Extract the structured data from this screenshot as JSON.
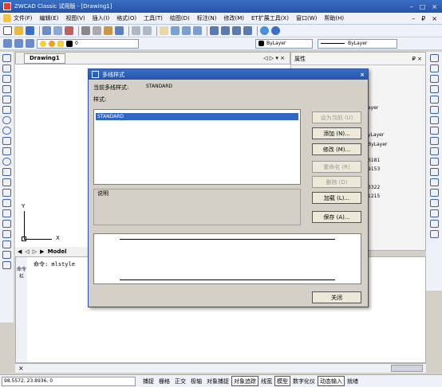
{
  "window": {
    "title": "ZWCAD Classic 试用版 - [Drawing1]",
    "controls": [
      "–",
      "□",
      "×"
    ],
    "doc_controls": [
      "–",
      "₽",
      "×"
    ]
  },
  "menu": [
    "文件(F)",
    "编辑(E)",
    "视图(V)",
    "插入(I)",
    "格式(O)",
    "工具(T)",
    "绘图(D)",
    "标注(N)",
    "修改(M)",
    "ET扩展工具(X)",
    "窗口(W)",
    "帮助(H)"
  ],
  "toolbar2": {
    "layer_value": "0",
    "color_value": "ByLayer",
    "linetype_value": "ByLayer"
  },
  "document": {
    "tab_label": "Drawing1",
    "tab_controls": "◁ ▷ ▾ ×",
    "model_tab": "Model",
    "axis_y": "Y",
    "axis_x": "X"
  },
  "properties": {
    "title": "属性",
    "close": "₽ ×",
    "values": [
      "ayer",
      "yLayer",
      "ByLayer",
      "6181",
      "9153",
      "3322",
      "1215"
    ]
  },
  "command": {
    "side_label": "命令栏",
    "text": "命令: mlstyle"
  },
  "status": {
    "coords": "98.5572,  23.8936,  0",
    "buttons": [
      {
        "label": "捕捉",
        "on": false
      },
      {
        "label": "栅格",
        "on": false
      },
      {
        "label": "正交",
        "on": false
      },
      {
        "label": "极轴",
        "on": false
      },
      {
        "label": "对象捕捉",
        "on": false
      },
      {
        "label": "对象追踪",
        "on": true
      },
      {
        "label": "线宽",
        "on": false
      },
      {
        "label": "模型",
        "on": true
      },
      {
        "label": "数字化仪",
        "on": false
      },
      {
        "label": "动态输入",
        "on": true
      },
      {
        "label": "就绪",
        "on": false
      }
    ]
  },
  "dialog": {
    "title": "多线样式",
    "current_label": "当前多线样式:",
    "current_value": "STANDARD",
    "styles_label": "样式:",
    "styles": [
      "STANDARD"
    ],
    "desc_label": "说明",
    "buttons": {
      "set_current": "设为当前 (U)",
      "new": "添加 (N)...",
      "modify": "修改 (M)...",
      "rename": "重命名 (R)",
      "delete": "删除 (D)",
      "load": "加载 (L)...",
      "save": "保存 (A)...",
      "close": "关闭"
    }
  }
}
